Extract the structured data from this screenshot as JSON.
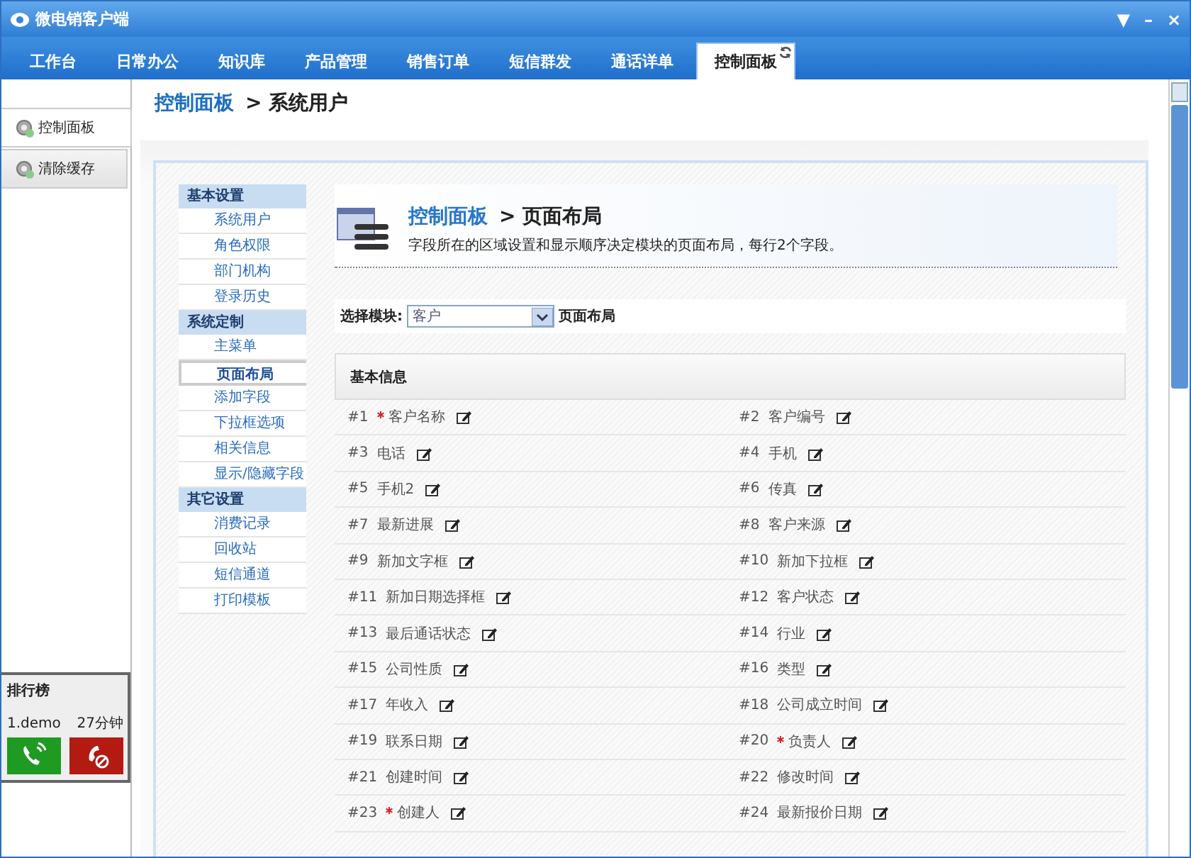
{
  "window": {
    "title": "微电销客户端",
    "controls": [
      "▼",
      "–",
      "×"
    ]
  },
  "tabs": [
    {
      "label": "工作台",
      "selected": false
    },
    {
      "label": "日常办公",
      "selected": false
    },
    {
      "label": "知识库",
      "selected": false
    },
    {
      "label": "产品管理",
      "selected": false
    },
    {
      "label": "销售订单",
      "selected": false
    },
    {
      "label": "短信群发",
      "selected": false
    },
    {
      "label": "通话详单",
      "selected": false
    },
    {
      "label": "控制面板",
      "selected": true
    }
  ],
  "sidebar": {
    "items": [
      {
        "label": "控制面板",
        "selected": true
      },
      {
        "label": "清除缓存",
        "selected": false
      }
    ]
  },
  "ranking": {
    "title": "排行榜",
    "entries": [
      {
        "name": "1.demo",
        "time": "27分钟"
      }
    ]
  },
  "breadcrumb": {
    "link": "控制面板",
    "current": "> 系统用户"
  },
  "settings_nav": [
    {
      "heading": "基本设置",
      "items": [
        {
          "label": "系统用户",
          "selected": false
        },
        {
          "label": "角色权限",
          "selected": false
        },
        {
          "label": "部门机构",
          "selected": false
        },
        {
          "label": "登录历史",
          "selected": false
        }
      ]
    },
    {
      "heading": "系统定制",
      "items": [
        {
          "label": "主菜单",
          "selected": false
        },
        {
          "label": "页面布局",
          "selected": true
        },
        {
          "label": "添加字段",
          "selected": false
        },
        {
          "label": "下拉框选项",
          "selected": false
        },
        {
          "label": "相关信息",
          "selected": false
        },
        {
          "label": "显示/隐藏字段",
          "selected": false
        }
      ]
    },
    {
      "heading": "其它设置",
      "items": [
        {
          "label": "消费记录",
          "selected": false
        },
        {
          "label": "回收站",
          "selected": false
        },
        {
          "label": "短信通道",
          "selected": false
        },
        {
          "label": "打印模板",
          "selected": false
        }
      ]
    }
  ],
  "page_header": {
    "link": "控制面板",
    "current": "> 页面布局",
    "description": "字段所在的区域设置和显示顺序决定模块的页面布局，每行2个字段。"
  },
  "module_select": {
    "label": "选择模块:",
    "value": "客户",
    "suffix": "页面布局"
  },
  "section": {
    "title": "基本信息",
    "fields": [
      {
        "number": "#1",
        "label": "客户名称",
        "required": true
      },
      {
        "number": "#2",
        "label": "客户编号",
        "required": false
      },
      {
        "number": "#3",
        "label": "电话",
        "required": false
      },
      {
        "number": "#4",
        "label": "手机",
        "required": false
      },
      {
        "number": "#5",
        "label": "手机2",
        "required": false
      },
      {
        "number": "#6",
        "label": "传真",
        "required": false
      },
      {
        "number": "#7",
        "label": "最新进展",
        "required": false
      },
      {
        "number": "#8",
        "label": "客户来源",
        "required": false
      },
      {
        "number": "#9",
        "label": "新加文字框",
        "required": false
      },
      {
        "number": "#10",
        "label": "新加下拉框",
        "required": false
      },
      {
        "number": "#11",
        "label": "新加日期选择框",
        "required": false
      },
      {
        "number": "#12",
        "label": "客户状态",
        "required": false
      },
      {
        "number": "#13",
        "label": "最后通话状态",
        "required": false
      },
      {
        "number": "#14",
        "label": "行业",
        "required": false
      },
      {
        "number": "#15",
        "label": "公司性质",
        "required": false
      },
      {
        "number": "#16",
        "label": "类型",
        "required": false
      },
      {
        "number": "#17",
        "label": "年收入",
        "required": false
      },
      {
        "number": "#18",
        "label": "公司成立时间",
        "required": false
      },
      {
        "number": "#19",
        "label": "联系日期",
        "required": false
      },
      {
        "number": "#20",
        "label": "负责人",
        "required": true
      },
      {
        "number": "#21",
        "label": "创建时间",
        "required": false
      },
      {
        "number": "#22",
        "label": "修改时间",
        "required": false
      },
      {
        "number": "#23",
        "label": "创建人",
        "required": true
      },
      {
        "number": "#24",
        "label": "最新报价日期",
        "required": false
      }
    ]
  }
}
